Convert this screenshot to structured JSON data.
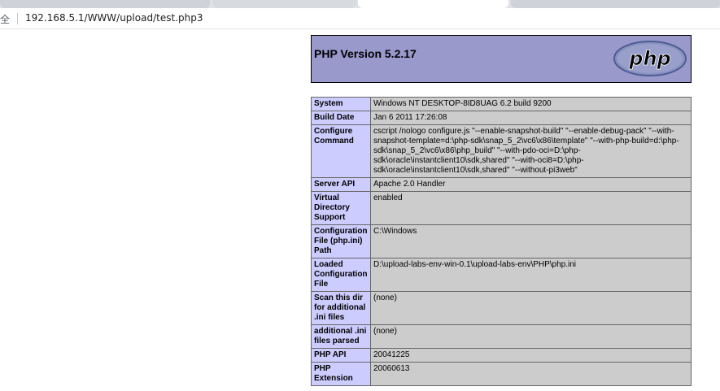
{
  "browser": {
    "secure_label": "全",
    "url": "192.168.5.1/WWW/upload/test.php3",
    "colors": {
      "tabbar": "#dfe1e5",
      "active_tab": "#ffffff"
    }
  },
  "phpinfo": {
    "title": "PHP Version 5.2.17",
    "logo_text": "php",
    "colors": {
      "header_bg": "#9999cc",
      "key_bg": "#ccccff",
      "value_bg": "#cccccc"
    },
    "rows": [
      {
        "key": "System",
        "value": "Windows NT DESKTOP-8ID8UAG 6.2 build 9200"
      },
      {
        "key": "Build Date",
        "value": "Jan 6 2011 17:26:08"
      },
      {
        "key": "Configure Command",
        "value": "cscript /nologo configure.js \"--enable-snapshot-build\" \"--enable-debug-pack\" \"--with-snapshot-template=d:\\php-sdk\\snap_5_2\\vc6\\x86\\template\" \"--with-php-build=d:\\php-sdk\\snap_5_2\\vc6\\x86\\php_build\" \"--with-pdo-oci=D:\\php-sdk\\oracle\\instantclient10\\sdk,shared\" \"--with-oci8=D:\\php-sdk\\oracle\\instantclient10\\sdk,shared\" \"--without-pi3web\""
      },
      {
        "key": "Server API",
        "value": "Apache 2.0 Handler"
      },
      {
        "key": "Virtual Directory Support",
        "value": "enabled"
      },
      {
        "key": "Configuration File (php.ini) Path",
        "value": "C:\\Windows"
      },
      {
        "key": "Loaded Configuration File",
        "value": "D:\\upload-labs-env-win-0.1\\upload-labs-env\\PHP\\php.ini"
      },
      {
        "key": "Scan this dir for additional .ini files",
        "value": "(none)"
      },
      {
        "key": "additional .ini files parsed",
        "value": "(none)"
      },
      {
        "key": "PHP API",
        "value": "20041225"
      },
      {
        "key": "PHP Extension",
        "value": "20060613"
      }
    ]
  }
}
